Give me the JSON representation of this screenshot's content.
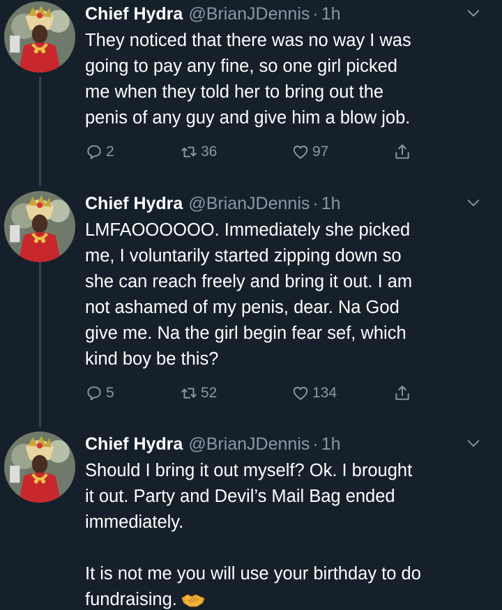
{
  "tweets": [
    {
      "author_name": "Chief Hydra",
      "handle": "@BrianJDennis",
      "separator": "·",
      "time": "1h",
      "lines": [
        "They noticed that there was no way I was",
        "going to pay any fine, so one girl picked",
        "me when they told her to bring out the",
        "penis of any guy and give him a blow job."
      ],
      "reply_count": "2",
      "retweet_count": "36",
      "like_count": "97"
    },
    {
      "author_name": "Chief Hydra",
      "handle": "@BrianJDennis",
      "separator": "·",
      "time": "1h",
      "lines": [
        "LMFAOOOOOO. Immediately she picked",
        "me, I voluntarily started zipping down so",
        "she can reach freely and bring it out. I am",
        "not ashamed of my penis, dear. Na God",
        "give me. Na the girl begin fear sef, which",
        "kind boy be this?"
      ],
      "reply_count": "5",
      "retweet_count": "52",
      "like_count": "134"
    },
    {
      "author_name": "Chief Hydra",
      "handle": "@BrianJDennis",
      "separator": "·",
      "time": "1h",
      "lines": [
        "Should I bring it out myself? Ok. I brought",
        "it out. Party and Devil’s Mail Bag ended",
        "immediately.",
        "",
        "It is not me you will use your birthday to do",
        "fundraising."
      ],
      "trailing_emoji": "handshake-emoji"
    }
  ],
  "icons": {
    "reply": "reply-icon",
    "retweet": "retweet-icon",
    "like": "heart-icon",
    "share": "share-icon",
    "more": "chevron-down-icon"
  },
  "colors": {
    "background": "#15202b",
    "text": "#ffffff",
    "muted": "#8899a6",
    "thread_line": "#38444d"
  }
}
